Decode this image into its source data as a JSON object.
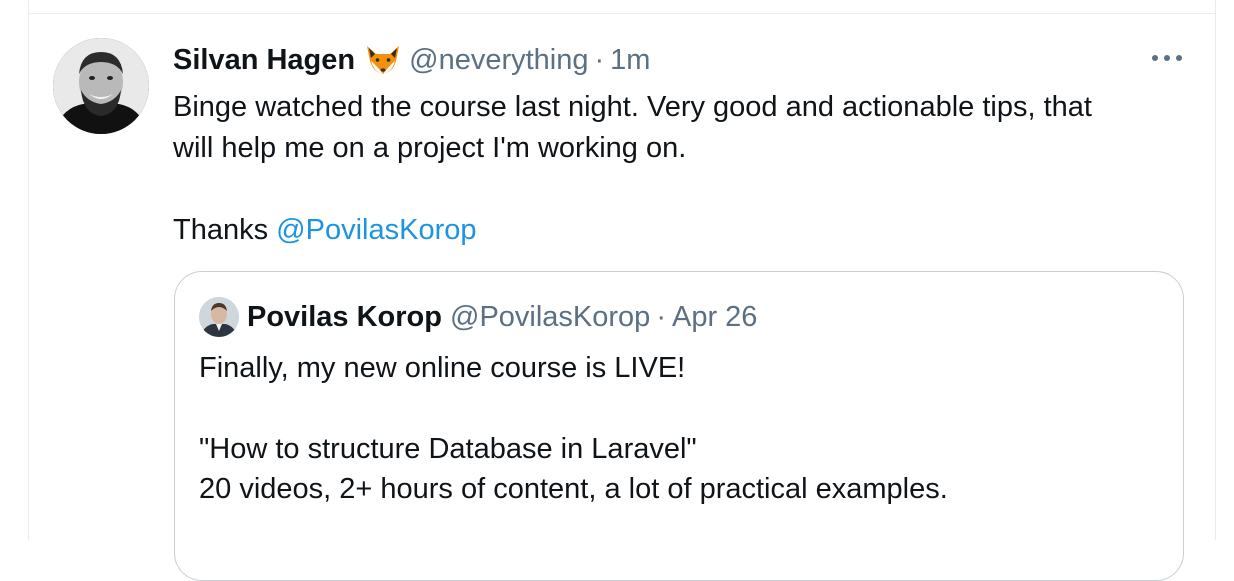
{
  "tweet": {
    "author": {
      "name": "Silvan Hagen",
      "handle": "@neverything",
      "emoji_icon": "fox-face-icon"
    },
    "separator": "·",
    "time": "1m",
    "more_icon": "more-dots-icon",
    "body": {
      "line1": "Binge watched the course last night. Very good and actionable tips, that",
      "line2": "will help me on a project I'm working on.",
      "thanks_prefix": "Thanks ",
      "mention": "@PovilasKorop"
    },
    "colors": {
      "mention": "#1b95e0",
      "secondary_text": "#5b7083",
      "quote_border": "#c4cfd6"
    }
  },
  "quoted": {
    "author": {
      "name": "Povilas Korop",
      "handle": "@PovilasKorop"
    },
    "separator": "·",
    "date": "Apr 26",
    "body": {
      "line1": "Finally, my new online course is LIVE!",
      "line2": "\"How to structure Database in Laravel\"",
      "line3": "20 videos, 2+ hours of content, a lot of practical examples."
    }
  }
}
